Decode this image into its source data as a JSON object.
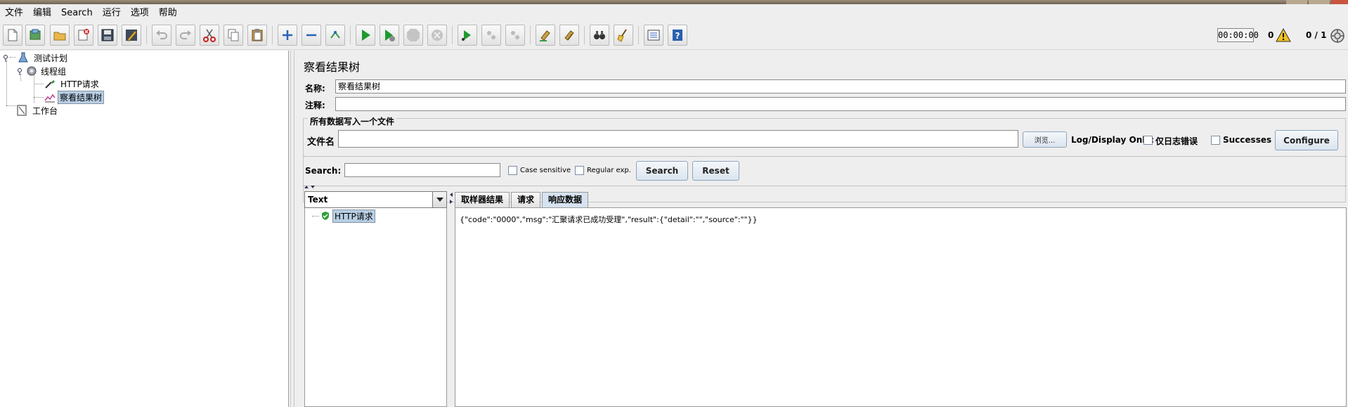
{
  "menu": {
    "items": [
      "文件",
      "编辑",
      "Search",
      "运行",
      "选项",
      "帮助"
    ]
  },
  "toolbar": {
    "timer": "00:00:00",
    "error_count": "0",
    "threads": "0 / 1",
    "icons": [
      "new-icon",
      "templates-icon",
      "open-icon",
      "close-icon",
      "save-icon",
      "save-as-icon",
      "undo-icon",
      "redo-icon",
      "cut-icon",
      "copy-icon",
      "paste-icon",
      "expand-icon",
      "collapse-icon",
      "toggle-icon",
      "start-icon",
      "start-no-pause-icon",
      "stop-icon",
      "shutdown-icon",
      "remote-start-icon",
      "remote-stop-icon",
      "remote-shutdown-icon",
      "clear-icon",
      "clear-all-icon",
      "search-binoculars-icon",
      "reset-search-broom-icon",
      "function-helper-icon",
      "help-icon"
    ]
  },
  "tree": {
    "test_plan": "测试计划",
    "thread_group": "线程组",
    "http_request": "HTTP请求",
    "view_results_tree": "察看结果树",
    "workbench": "工作台"
  },
  "panel": {
    "title": "察看结果树",
    "name_label": "名称:",
    "name_value": "察看结果树",
    "comment_label": "注释:",
    "comment_value": "",
    "group_title": "所有数据写入一个文件",
    "filename_label": "文件名",
    "filename_value": "",
    "browse_label": "浏览...",
    "log_display_label": "Log/Display Only:",
    "errors_only_label": "仅日志错误",
    "successes_label": "Successes",
    "configure_label": "Configure"
  },
  "search": {
    "label": "Search:",
    "value": "",
    "case_sensitive_label": "Case sensitive",
    "regex_label": "Regular exp.",
    "search_button": "Search",
    "reset_button": "Reset"
  },
  "results": {
    "renderer": "Text",
    "sampler_label": "HTTP请求",
    "tabs": [
      "取样器结果",
      "请求",
      "响应数据"
    ],
    "active_tab": "响应数据",
    "response_body": "{\"code\":\"0000\",\"msg\":\"汇聚请求已成功受理\",\"result\":{\"detail\":\"\",\"source\":\"\"}}"
  },
  "colors": {
    "selection": "#b8cfe5",
    "button_border": "#8fa4bd",
    "success_green": "#2e9e3a"
  }
}
